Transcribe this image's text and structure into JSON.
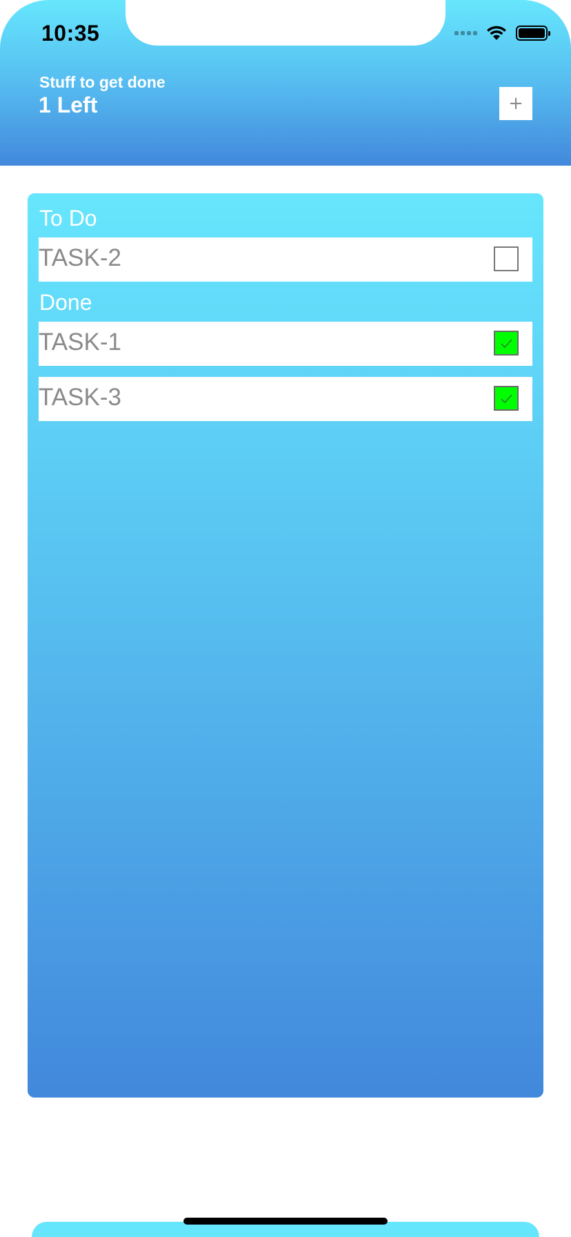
{
  "status_bar": {
    "time": "10:35",
    "icons": [
      "cellular-signal-icon",
      "wifi-icon",
      "battery-icon"
    ]
  },
  "header": {
    "subtitle": "Stuff to get done",
    "title": "1 Left",
    "add_button_label": "+"
  },
  "sections": {
    "todo": {
      "title": "To Do",
      "tasks": [
        {
          "label": "TASK-2",
          "done": false
        }
      ]
    },
    "done": {
      "title": "Done",
      "tasks": [
        {
          "label": "TASK-1",
          "done": true
        },
        {
          "label": "TASK-3",
          "done": true
        }
      ]
    }
  },
  "colors": {
    "gradient_top": "#66e6fd",
    "gradient_bottom": "#4288dc",
    "checked_fill": "#00ff00",
    "task_text": "#8a8a8a"
  }
}
